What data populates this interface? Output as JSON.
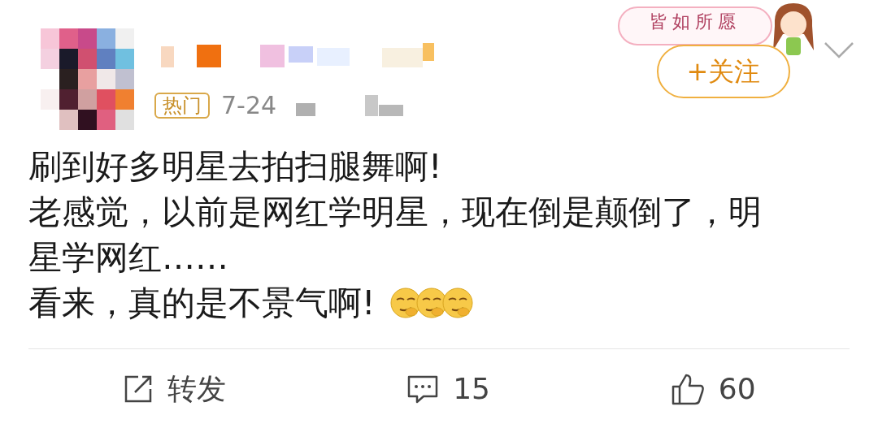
{
  "post": {
    "badge": "热门",
    "date": "7-24",
    "follow_button": "+关注",
    "decoration_text": "皆如所愿",
    "lines": [
      {
        "text": "刷到好多明星去拍扫腿舞啊!"
      },
      {
        "text": "老感觉，以前是网红学明星，现在倒是颠倒了，明星学网红……"
      },
      {
        "text": "看来，真的是不景气啊!",
        "emojis": [
          {
            "kind": "smirk"
          },
          {
            "kind": "smirk"
          },
          {
            "kind": "smirk"
          }
        ]
      }
    ]
  },
  "actions": [
    {
      "kind": "share",
      "label": "转发"
    },
    {
      "kind": "comment",
      "label": "15"
    },
    {
      "kind": "like",
      "label": "60"
    }
  ]
}
